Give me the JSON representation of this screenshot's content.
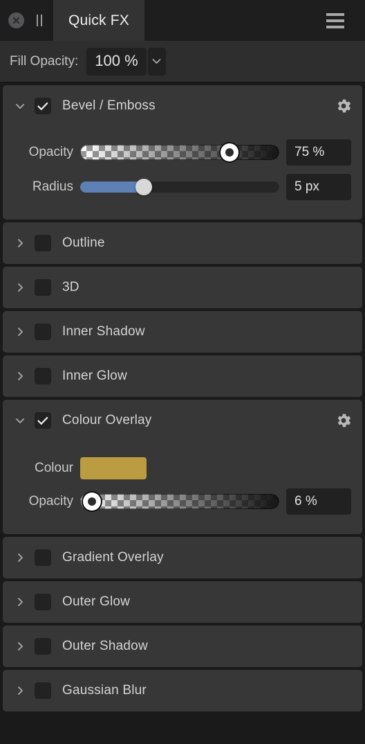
{
  "window": {
    "title": "Quick FX",
    "close_icon": "close-circle-icon",
    "pause_icon": "pause-bars-icon",
    "menu_icon": "hamburger-menu-icon"
  },
  "fill_opacity": {
    "label": "Fill Opacity:",
    "value": "100 %",
    "dropdown_icon": "chevron-down-icon"
  },
  "colors": {
    "panel_bg": "#1a1a1a",
    "row_bg": "#373737",
    "header_bg": "#1e1e1e",
    "tab_bg": "#333333",
    "field_bg": "#212121",
    "slider_blue": "#5d81b4",
    "text": "#d4d4d4",
    "overlay_colour": "#bb9c40"
  },
  "effects": [
    {
      "name": "Bevel / Emboss",
      "expanded": true,
      "enabled": true,
      "chevron": "chevron-down-icon",
      "gear": "gear-icon",
      "params": [
        {
          "type": "alpha-slider",
          "label": "Opacity",
          "value": "75 %",
          "percent": 75
        },
        {
          "type": "blue-slider",
          "label": "Radius",
          "value": "5 px",
          "percent": 32
        }
      ]
    },
    {
      "name": "Outline",
      "expanded": false,
      "enabled": false,
      "chevron": "chevron-right-icon"
    },
    {
      "name": "3D",
      "expanded": false,
      "enabled": false,
      "chevron": "chevron-right-icon"
    },
    {
      "name": "Inner Shadow",
      "expanded": false,
      "enabled": false,
      "chevron": "chevron-right-icon"
    },
    {
      "name": "Inner Glow",
      "expanded": false,
      "enabled": false,
      "chevron": "chevron-right-icon"
    },
    {
      "name": "Colour Overlay",
      "expanded": true,
      "enabled": true,
      "chevron": "chevron-down-icon",
      "gear": "gear-icon",
      "params": [
        {
          "type": "swatch",
          "label": "Colour",
          "value": "#bb9c40"
        },
        {
          "type": "alpha-slider",
          "label": "Opacity",
          "value": "6 %",
          "percent": 6
        }
      ]
    },
    {
      "name": "Gradient Overlay",
      "expanded": false,
      "enabled": false,
      "chevron": "chevron-right-icon"
    },
    {
      "name": "Outer Glow",
      "expanded": false,
      "enabled": false,
      "chevron": "chevron-right-icon"
    },
    {
      "name": "Outer Shadow",
      "expanded": false,
      "enabled": false,
      "chevron": "chevron-right-icon"
    },
    {
      "name": "Gaussian Blur",
      "expanded": false,
      "enabled": false,
      "chevron": "chevron-right-icon"
    }
  ]
}
